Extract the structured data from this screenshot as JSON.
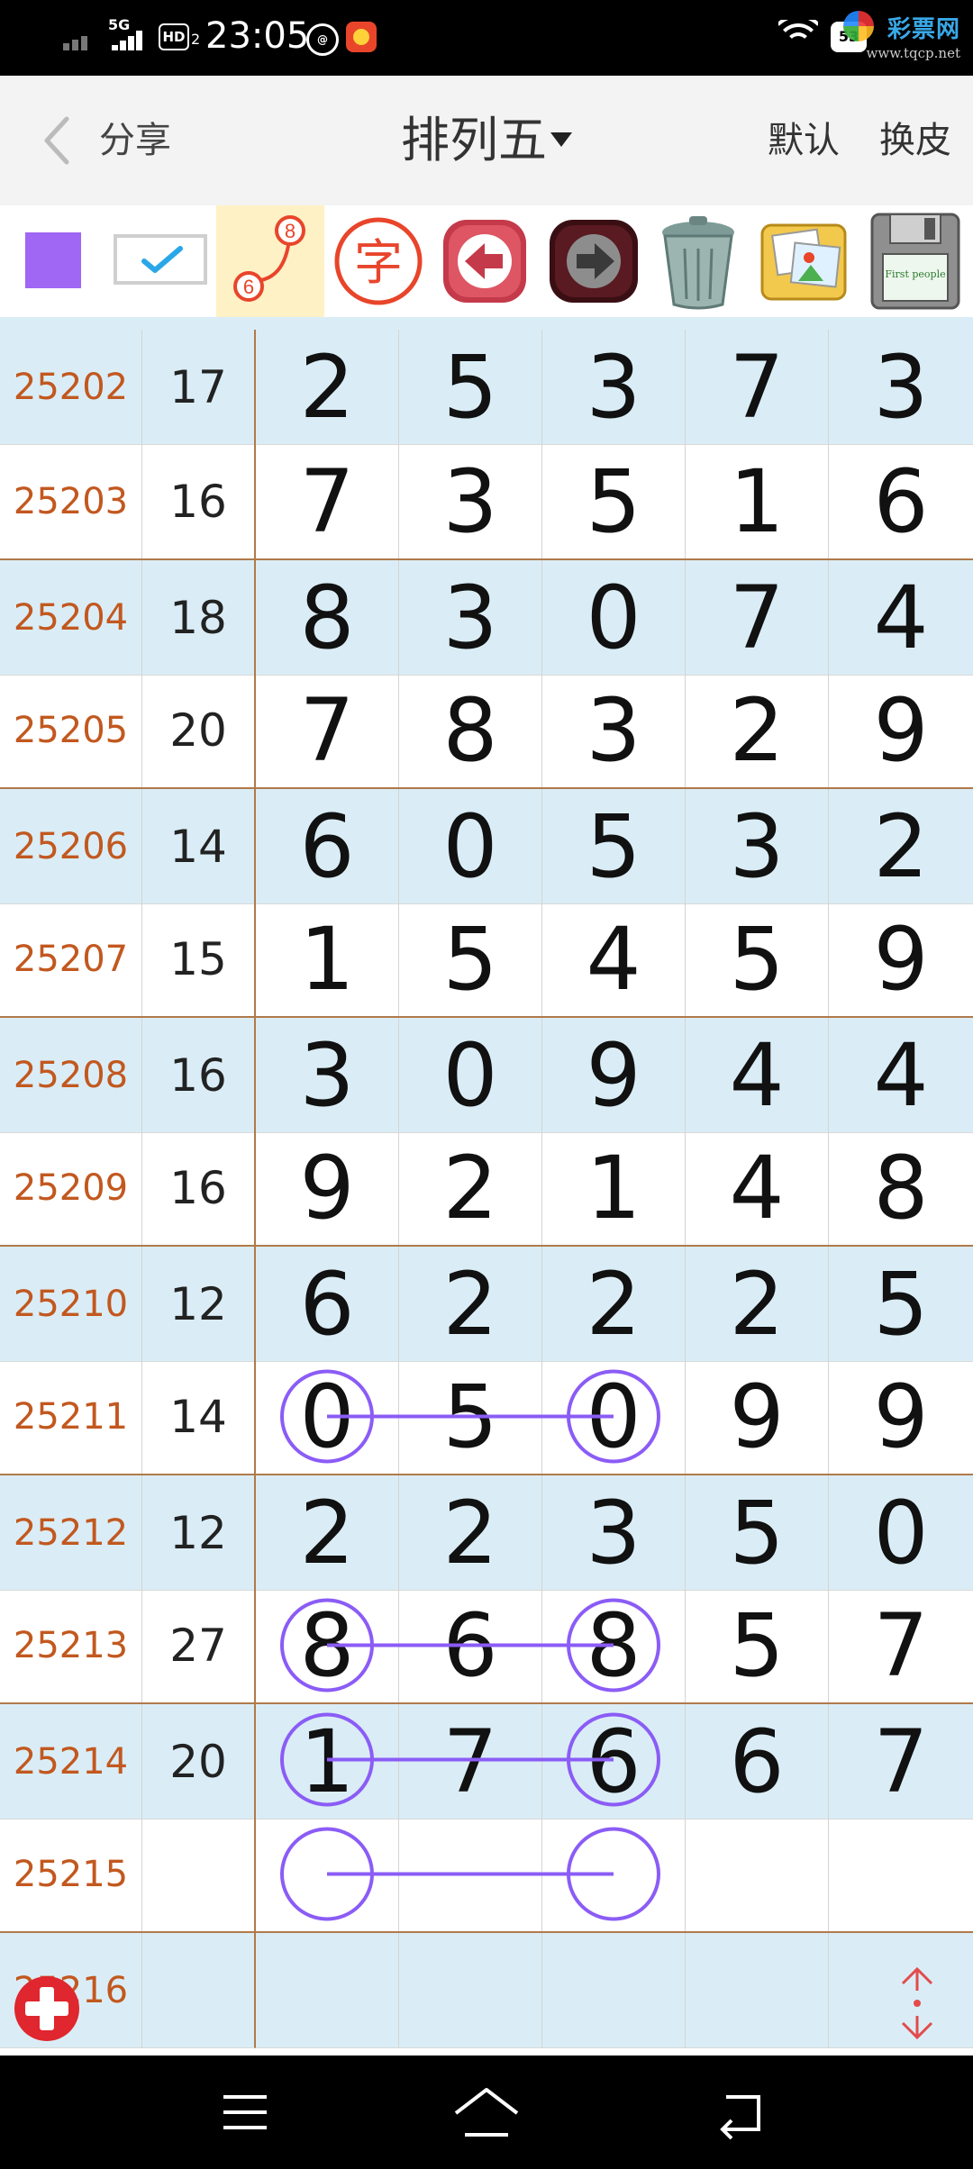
{
  "status_bar": {
    "network": "5G",
    "hd": "HD",
    "hd_sub": "2",
    "time": "23:05",
    "battery": "53",
    "icons": [
      "signal-icon",
      "hd-icon",
      "app-notification-icon",
      "app-game-icon",
      "wifi-icon",
      "battery-icon"
    ]
  },
  "watermark": {
    "title": "彩票网",
    "url": "www.tqcp.net"
  },
  "header": {
    "share_label": "分享",
    "title": "排列五",
    "default_label": "默认",
    "skin_label": "换皮"
  },
  "toolbar": {
    "color_swatch": "#a066f4",
    "zi_label": "字",
    "link_numbers": [
      "8",
      "6"
    ],
    "save_label": "First people"
  },
  "colors": {
    "issue_text": "#c2581f",
    "row_shade": "#daedf6",
    "separator": "#b07a4a",
    "mark": "#8b5cf6"
  },
  "rows": [
    {
      "issue": "25202",
      "sum": "17",
      "digits": [
        "2",
        "5",
        "3",
        "7",
        "3"
      ]
    },
    {
      "issue": "25203",
      "sum": "16",
      "digits": [
        "7",
        "3",
        "5",
        "1",
        "6"
      ]
    },
    {
      "issue": "25204",
      "sum": "18",
      "digits": [
        "8",
        "3",
        "0",
        "7",
        "4"
      ]
    },
    {
      "issue": "25205",
      "sum": "20",
      "digits": [
        "7",
        "8",
        "3",
        "2",
        "9"
      ]
    },
    {
      "issue": "25206",
      "sum": "14",
      "digits": [
        "6",
        "0",
        "5",
        "3",
        "2"
      ]
    },
    {
      "issue": "25207",
      "sum": "15",
      "digits": [
        "1",
        "5",
        "4",
        "5",
        "9"
      ]
    },
    {
      "issue": "25208",
      "sum": "16",
      "digits": [
        "3",
        "0",
        "9",
        "4",
        "4"
      ]
    },
    {
      "issue": "25209",
      "sum": "16",
      "digits": [
        "9",
        "2",
        "1",
        "4",
        "8"
      ]
    },
    {
      "issue": "25210",
      "sum": "12",
      "digits": [
        "6",
        "2",
        "2",
        "2",
        "5"
      ]
    },
    {
      "issue": "25211",
      "sum": "14",
      "digits": [
        "0",
        "5",
        "0",
        "9",
        "9"
      ]
    },
    {
      "issue": "25212",
      "sum": "12",
      "digits": [
        "2",
        "2",
        "3",
        "5",
        "0"
      ]
    },
    {
      "issue": "25213",
      "sum": "27",
      "digits": [
        "8",
        "6",
        "8",
        "5",
        "7"
      ]
    },
    {
      "issue": "25214",
      "sum": "20",
      "digits": [
        "1",
        "7",
        "6",
        "6",
        "7"
      ]
    },
    {
      "issue": "25215",
      "sum": "",
      "digits": [
        "",
        "",
        "",
        "",
        ""
      ]
    },
    {
      "issue": "25216",
      "sum": "",
      "digits": [
        "",
        "",
        "",
        "",
        ""
      ]
    }
  ],
  "marked_rows": [
    9,
    11,
    12,
    13
  ]
}
